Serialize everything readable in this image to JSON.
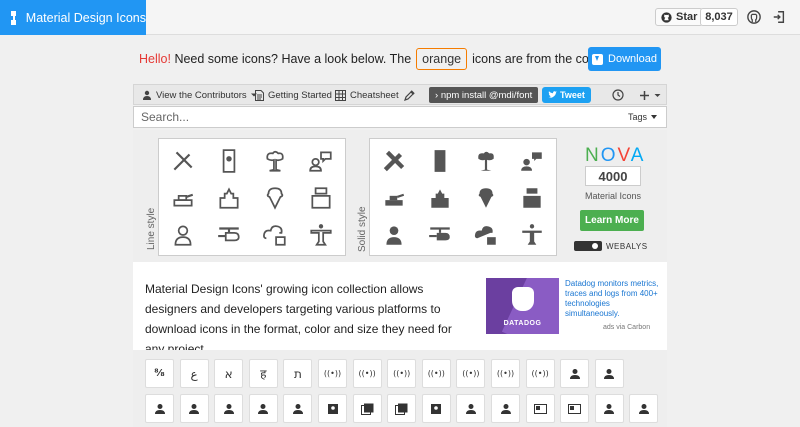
{
  "header": {
    "title": "Material Design Icons",
    "github_star_label": "Star",
    "github_star_count": "8,037",
    "icons": [
      "mdi-logo-icon",
      "github-icon",
      "github-octocat-icon",
      "login-icon"
    ]
  },
  "intro": {
    "hello": "Hello!",
    "text_before": "Need some icons? Have a look below. The",
    "badge": "orange",
    "text_after": "icons are from the community.",
    "download_label": "Download"
  },
  "toolbar": {
    "contributors_label": "View the Contributors",
    "getting_started_label": "Getting Started",
    "cheatsheet_label": "Cheatsheet",
    "npm_command": "npm install @mdi/font",
    "tweet_label": "Tweet"
  },
  "search": {
    "placeholder": "Search...",
    "tags_label": "Tags"
  },
  "styles": {
    "line_label": "Line style",
    "solid_label": "Solid style",
    "icons": [
      "pencil-ruler-icon",
      "contact-card-icon",
      "explosion-icon",
      "chat-person-icon",
      "tank-icon",
      "temple-icon",
      "ice-cream-icon",
      "cash-register-icon",
      "person-thinking-icon",
      "helicopter-icon",
      "cloud-lock-icon",
      "statue-icon"
    ]
  },
  "nova": {
    "title_letters": [
      "N",
      "O",
      "V",
      "A"
    ],
    "title_colors": [
      "#4caf50",
      "#2196f3",
      "#f44336",
      "#03a9f4"
    ],
    "count": "4000",
    "subtitle": "Material Icons",
    "learn_more": "Learn More",
    "webalys": "WEBALYS"
  },
  "description": {
    "text": "Material Design Icons' growing icon collection allows designers and developers targeting various platforms to download icons in the format, color and size they need for any project.",
    "ad_brand": "DATADOG",
    "ad_text": "Datadog monitors metrics, traces and logs from 400+ technologies simultaneously.",
    "ad_via": "ads via Carbon"
  },
  "icon_grid": {
    "row1": [
      "ab-fraction",
      "ع",
      "א",
      "ह",
      "ת",
      "((•))",
      "((•))",
      "((•))",
      "((•))",
      "((•))",
      "((•))",
      "((•))",
      "person",
      "person"
    ],
    "row2": [
      "person",
      "person",
      "person",
      "person",
      "person",
      "badge",
      "badges",
      "badges",
      "badge",
      "person",
      "person",
      "card",
      "card",
      "person",
      "person"
    ]
  },
  "colors": {
    "brand": "#2196f3",
    "accent_orange": "#f57c00",
    "hello_red": "#e53935",
    "learn_green": "#4caf50"
  }
}
